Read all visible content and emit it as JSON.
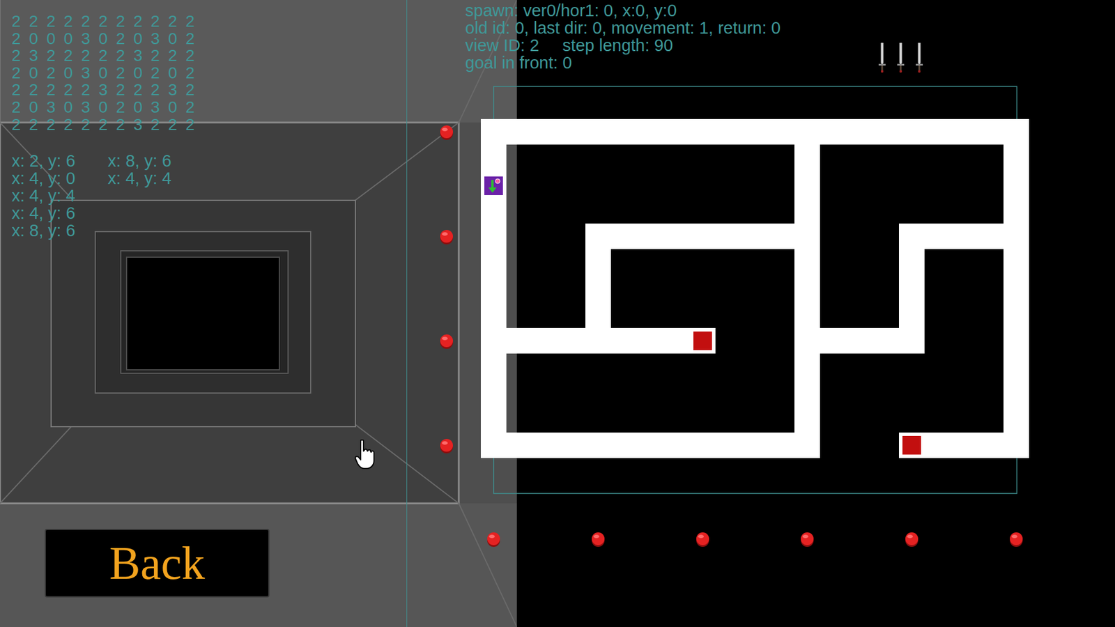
{
  "debug": {
    "lines": [
      "spawn: ver0/hor1: 0, x:0, y:0",
      "old id: 0, last dir: 0, movement: 1, return: 0",
      "view ID: 2     step length: 90",
      "goal in front: 0"
    ]
  },
  "grid": {
    "rows": [
      "2 2 2 2 2 2 2 2 2 2 2",
      "2 0 0 0 3 0 2 0 3 0 2",
      "2 3 2 2 2 2 2 3 2 2 2",
      "2 0 2 0 3 0 2 0 2 0 2",
      "2 2 2 2 2 3 2 2 2 3 2",
      "2 0 3 0 3 0 2 0 3 0 2",
      "2 2 2 2 2 2 2 3 2 2 2"
    ]
  },
  "visited": [
    "x: 2, y: 6",
    "x: 4, y: 0",
    "x: 4, y: 4",
    "x: 4, y: 6",
    "x: 8, y: 6"
  ],
  "goals": [
    "x: 8, y: 6",
    "x: 4, y: 4"
  ],
  "weapons": [
    {
      "kind": "sword"
    },
    {
      "kind": "sword"
    },
    {
      "kind": "sword"
    }
  ],
  "player": {
    "facing": "down"
  },
  "back_button": {
    "label": "Back"
  }
}
